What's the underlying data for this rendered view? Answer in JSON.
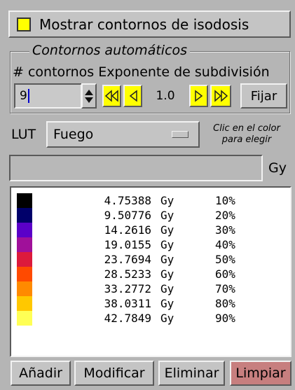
{
  "toggle": {
    "label": "Mostrar contornos de isodosis",
    "checked": true,
    "color": "#ffff00"
  },
  "auto_group": {
    "title": "Contornos automáticos",
    "labels": "# contornos Exponente de subdivisión",
    "count_value": "9",
    "subdivision_value": "1.0",
    "apply_label": "Fijar",
    "nav_icons": [
      "first-icon",
      "prev-icon",
      "next-icon",
      "last-icon"
    ]
  },
  "lut": {
    "label": "LUT",
    "selected": "Fuego",
    "hint": "Clic en el color para elegir"
  },
  "gy_field": {
    "value": "",
    "unit": "Gy"
  },
  "contours": [
    {
      "color": "#000000",
      "dose": "4.75388",
      "unit": "Gy",
      "percent": "10%"
    },
    {
      "color": "#00006a",
      "dose": "9.50776",
      "unit": "Gy",
      "percent": "20%"
    },
    {
      "color": "#5a00c8",
      "dose": "14.2616",
      "unit": "Gy",
      "percent": "30%"
    },
    {
      "color": "#a0109a",
      "dose": "19.0155",
      "unit": "Gy",
      "percent": "40%"
    },
    {
      "color": "#dc1a3c",
      "dose": "23.7694",
      "unit": "Gy",
      "percent": "50%"
    },
    {
      "color": "#ff4a00",
      "dose": "28.5233",
      "unit": "Gy",
      "percent": "60%"
    },
    {
      "color": "#ff8a00",
      "dose": "33.2772",
      "unit": "Gy",
      "percent": "70%"
    },
    {
      "color": "#ffc800",
      "dose": "38.0311",
      "unit": "Gy",
      "percent": "80%"
    },
    {
      "color": "#ffff55",
      "dose": "42.7849",
      "unit": "Gy",
      "percent": "90%"
    }
  ],
  "buttons": {
    "add": "Añadir",
    "modify": "Modificar",
    "delete": "Eliminar",
    "clear": "Limpiar",
    "clear_color": "#c77f7f"
  }
}
